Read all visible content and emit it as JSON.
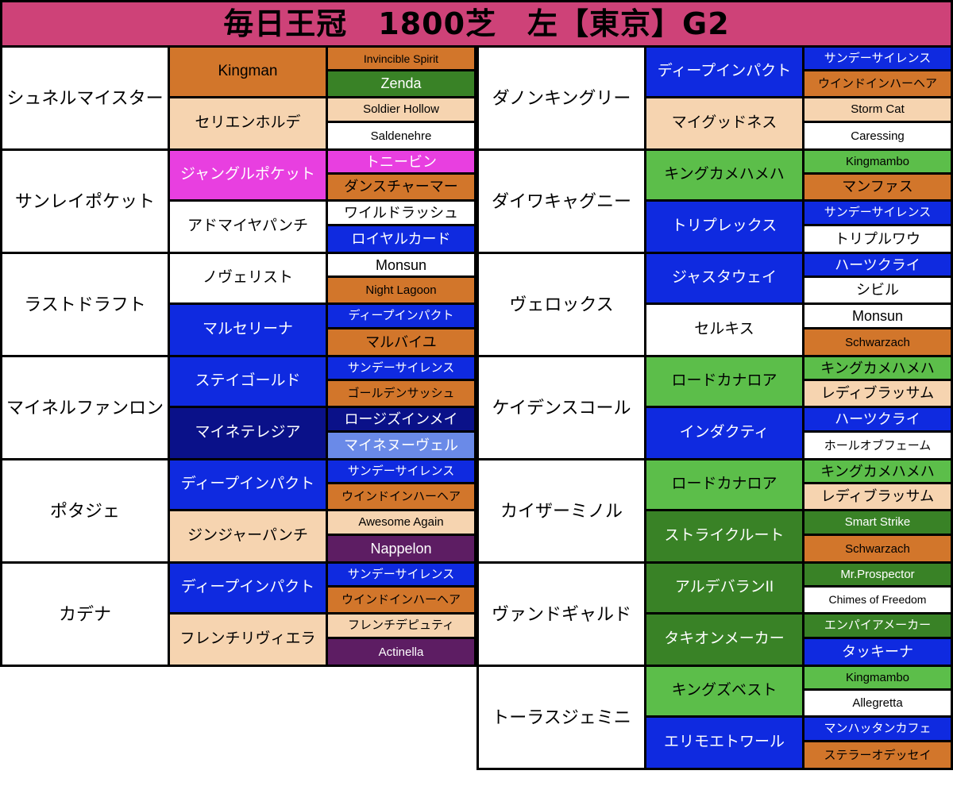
{
  "header": {
    "title": "毎日王冠　1800芝　左【東京】G2",
    "bg_color": "#ce4278"
  },
  "palette": {
    "white": "#ffffff",
    "orange": "#d2762b",
    "peach": "#f6d4b0",
    "dark_green": "#398226",
    "light_green": "#5cbe4a",
    "blue": "#0f2ae0",
    "navy": "#0a1189",
    "light_blue": "#6a8ae8",
    "magenta": "#e83fe0",
    "purple": "#5d1d63",
    "pink": "#ce4278"
  },
  "left_column": [
    {
      "name": "シュネルマイスター",
      "name_color": "white",
      "sire": {
        "label": "Kingman",
        "color": "orange",
        "latin": true
      },
      "sire_sire": {
        "label": "Invincible Spirit",
        "color": "orange",
        "latin": true
      },
      "sire_dam": {
        "label": "Zenda",
        "color": "dark_green",
        "latin": true
      },
      "dam": {
        "label": "セリエンホルデ",
        "color": "peach"
      },
      "dam_sire": {
        "label": "Soldier Hollow",
        "color": "peach",
        "latin": true
      },
      "dam_dam": {
        "label": "Saldenehre",
        "color": "white",
        "latin": true
      }
    },
    {
      "name": "サンレイポケット",
      "name_color": "white",
      "sire": {
        "label": "ジャングルポケット",
        "color": "magenta"
      },
      "sire_sire": {
        "label": "トニービン",
        "color": "magenta"
      },
      "sire_dam": {
        "label": "ダンスチャーマー",
        "color": "orange"
      },
      "dam": {
        "label": "アドマイヤパンチ",
        "color": "white"
      },
      "dam_sire": {
        "label": "ワイルドラッシュ",
        "color": "white"
      },
      "dam_dam": {
        "label": "ロイヤルカード",
        "color": "blue"
      }
    },
    {
      "name": "ラストドラフト",
      "name_color": "white",
      "sire": {
        "label": "ノヴェリスト",
        "color": "white"
      },
      "sire_sire": {
        "label": "Monsun",
        "color": "white",
        "latin": true
      },
      "sire_dam": {
        "label": "Night Lagoon",
        "color": "orange",
        "latin": true
      },
      "dam": {
        "label": "マルセリーナ",
        "color": "blue"
      },
      "dam_sire": {
        "label": "ディープインパクト",
        "color": "blue"
      },
      "dam_dam": {
        "label": "マルバイユ",
        "color": "orange"
      }
    },
    {
      "name": "マイネルファンロン",
      "name_color": "white",
      "sire": {
        "label": "ステイゴールド",
        "color": "blue"
      },
      "sire_sire": {
        "label": "サンデーサイレンス",
        "color": "blue"
      },
      "sire_dam": {
        "label": "ゴールデンサッシュ",
        "color": "orange"
      },
      "dam": {
        "label": "マイネテレジア",
        "color": "navy"
      },
      "dam_sire": {
        "label": "ロージズインメイ",
        "color": "navy"
      },
      "dam_dam": {
        "label": "マイネヌーヴェル",
        "color": "light_blue"
      }
    },
    {
      "name": "ポタジェ",
      "name_color": "white",
      "sire": {
        "label": "ディープインパクト",
        "color": "blue"
      },
      "sire_sire": {
        "label": "サンデーサイレンス",
        "color": "blue"
      },
      "sire_dam": {
        "label": "ウインドインハーヘア",
        "color": "orange"
      },
      "dam": {
        "label": "ジンジャーパンチ",
        "color": "peach"
      },
      "dam_sire": {
        "label": "Awesome Again",
        "color": "peach",
        "latin": true
      },
      "dam_dam": {
        "label": "Nappelon",
        "color": "purple",
        "latin": true
      }
    },
    {
      "name": "カデナ",
      "name_color": "white",
      "sire": {
        "label": "ディープインパクト",
        "color": "blue"
      },
      "sire_sire": {
        "label": "サンデーサイレンス",
        "color": "blue"
      },
      "sire_dam": {
        "label": "ウインドインハーヘア",
        "color": "orange"
      },
      "dam": {
        "label": "フレンチリヴィエラ",
        "color": "peach"
      },
      "dam_sire": {
        "label": "フレンチデピュティ",
        "color": "peach"
      },
      "dam_dam": {
        "label": "Actinella",
        "color": "purple",
        "latin": true
      }
    }
  ],
  "right_column": [
    {
      "name": "ダノンキングリー",
      "name_color": "white",
      "sire": {
        "label": "ディープインパクト",
        "color": "blue"
      },
      "sire_sire": {
        "label": "サンデーサイレンス",
        "color": "blue"
      },
      "sire_dam": {
        "label": "ウインドインハーヘア",
        "color": "orange"
      },
      "dam": {
        "label": "マイグッドネス",
        "color": "peach"
      },
      "dam_sire": {
        "label": "Storm Cat",
        "color": "peach",
        "latin": true
      },
      "dam_dam": {
        "label": "Caressing",
        "color": "white",
        "latin": true
      }
    },
    {
      "name": "ダイワキャグニー",
      "name_color": "white",
      "sire": {
        "label": "キングカメハメハ",
        "color": "light_green"
      },
      "sire_sire": {
        "label": "Kingmambo",
        "color": "light_green",
        "latin": true
      },
      "sire_dam": {
        "label": "マンファス",
        "color": "orange"
      },
      "dam": {
        "label": "トリプレックス",
        "color": "blue"
      },
      "dam_sire": {
        "label": "サンデーサイレンス",
        "color": "blue"
      },
      "dam_dam": {
        "label": "トリプルワウ",
        "color": "white"
      }
    },
    {
      "name": "ヴェロックス",
      "name_color": "white",
      "sire": {
        "label": "ジャスタウェイ",
        "color": "blue"
      },
      "sire_sire": {
        "label": "ハーツクライ",
        "color": "blue"
      },
      "sire_dam": {
        "label": "シビル",
        "color": "white"
      },
      "dam": {
        "label": "セルキス",
        "color": "white"
      },
      "dam_sire": {
        "label": "Monsun",
        "color": "white",
        "latin": true
      },
      "dam_dam": {
        "label": "Schwarzach",
        "color": "orange",
        "latin": true
      }
    },
    {
      "name": "ケイデンスコール",
      "name_color": "white",
      "sire": {
        "label": "ロードカナロア",
        "color": "light_green"
      },
      "sire_sire": {
        "label": "キングカメハメハ",
        "color": "light_green"
      },
      "sire_dam": {
        "label": "レディブラッサム",
        "color": "peach"
      },
      "dam": {
        "label": "インダクティ",
        "color": "blue"
      },
      "dam_sire": {
        "label": "ハーツクライ",
        "color": "blue"
      },
      "dam_dam": {
        "label": "ホールオブフェーム",
        "color": "white"
      }
    },
    {
      "name": "カイザーミノル",
      "name_color": "white",
      "sire": {
        "label": "ロードカナロア",
        "color": "light_green"
      },
      "sire_sire": {
        "label": "キングカメハメハ",
        "color": "light_green"
      },
      "sire_dam": {
        "label": "レディブラッサム",
        "color": "peach"
      },
      "dam": {
        "label": "ストライクルート",
        "color": "dark_green"
      },
      "dam_sire": {
        "label": "Smart Strike",
        "color": "dark_green",
        "latin": true
      },
      "dam_dam": {
        "label": "Schwarzach",
        "color": "orange",
        "latin": true
      }
    },
    {
      "name": "ヴァンドギャルド",
      "name_color": "white",
      "sire": {
        "label": "アルデバランII",
        "color": "dark_green"
      },
      "sire_sire": {
        "label": "Mr.Prospector",
        "color": "dark_green",
        "latin": true
      },
      "sire_dam": {
        "label": "Chimes of Freedom",
        "color": "white",
        "latin": true
      },
      "dam": {
        "label": "タキオンメーカー",
        "color": "dark_green"
      },
      "dam_sire": {
        "label": "エンパイアメーカー",
        "color": "dark_green"
      },
      "dam_dam": {
        "label": "タッキーナ",
        "color": "blue"
      }
    },
    {
      "name": "トーラスジェミニ",
      "name_color": "white",
      "sire": {
        "label": "キングズベスト",
        "color": "light_green"
      },
      "sire_sire": {
        "label": "Kingmambo",
        "color": "light_green",
        "latin": true
      },
      "sire_dam": {
        "label": "Allegretta",
        "color": "white",
        "latin": true
      },
      "dam": {
        "label": "エリモエトワール",
        "color": "blue"
      },
      "dam_sire": {
        "label": "マンハッタンカフェ",
        "color": "blue"
      },
      "dam_dam": {
        "label": "ステラーオデッセイ",
        "color": "orange"
      }
    }
  ]
}
